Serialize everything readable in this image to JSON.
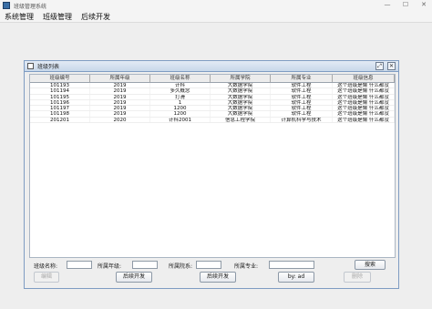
{
  "window": {
    "title": "班级管理系统"
  },
  "menu": [
    "系统管理",
    "班级管理",
    "后续开发"
  ],
  "frame": {
    "title": "班级列表"
  },
  "table": {
    "columns": [
      "班级编号",
      "所属年级",
      "班级名称",
      "所属学院",
      "所属专业",
      "班级信息"
    ],
    "rows": [
      [
        "101193",
        "2019",
        "计科",
        "大数据学院",
        "软件工程",
        "这个班级是懒 什么都没"
      ],
      [
        "101194",
        "2019",
        "多久概念",
        "大数据学院",
        "软件工程",
        "这个班级是懒 什么都没"
      ],
      [
        "101195",
        "2019",
        "打滑",
        "大数据学院",
        "软件工程",
        "这个班级是懒 什么都没"
      ],
      [
        "101196",
        "2019",
        "1",
        "大数据学院",
        "软件工程",
        "这个班级是懒 什么都没"
      ],
      [
        "101197",
        "2019",
        "1200",
        "大数据学院",
        "软件工程",
        "这个班级是懒 什么都没"
      ],
      [
        "101198",
        "2019",
        "1200",
        "大数据学院",
        "软件工程",
        "这个班级是懒 什么都没"
      ],
      [
        "201201",
        "2020",
        "计科2001",
        "信息工程学院",
        "计算机科学与技术",
        "这个班级是懒 什么都没"
      ]
    ]
  },
  "filters": {
    "class_name_label": "班级名称:",
    "grade_label": "所属年级:",
    "college_label": "所属院系:",
    "major_label": "所属专业:",
    "search_label": "搜索"
  },
  "actions": {
    "edit_label": "编辑",
    "follow_dev_1_label": "后续开发",
    "follow_dev_2_label": "后续开发",
    "by_label": "by:  ad",
    "delete_label": "删除"
  }
}
